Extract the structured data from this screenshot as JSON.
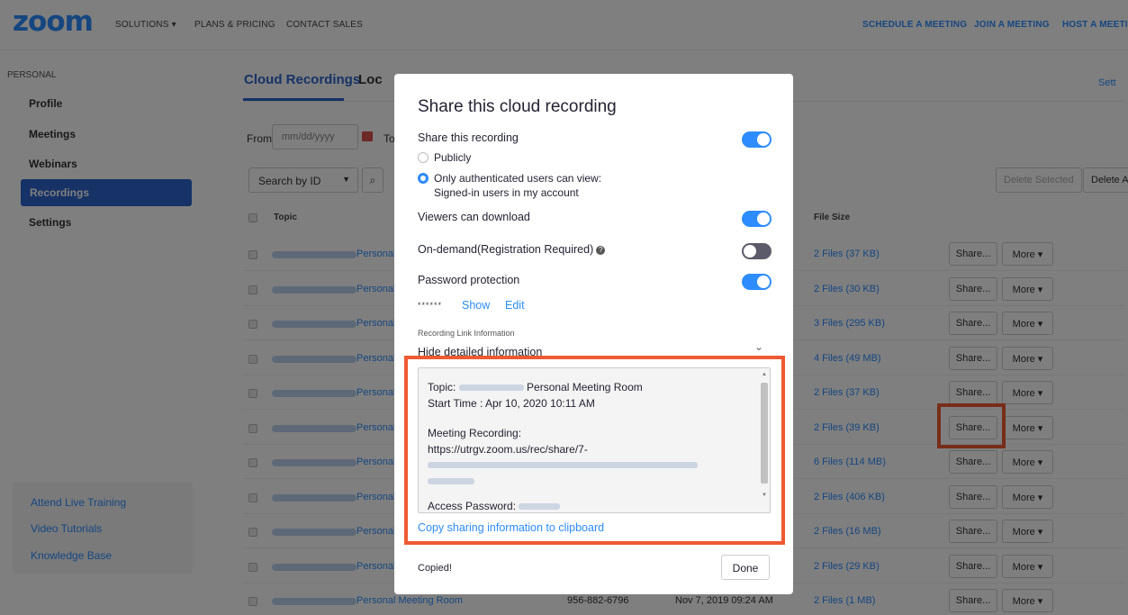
{
  "nav": {
    "logo": "zoom",
    "solutions": "SOLUTIONS ▾",
    "plans": "PLANS & PRICING",
    "contact": "CONTACT SALES",
    "schedule": "SCHEDULE A MEETING",
    "join": "JOIN A MEETING",
    "host": "HOST A MEETING"
  },
  "sidebar": {
    "heading": "PERSONAL",
    "items": [
      "Profile",
      "Meetings",
      "Webinars",
      "Recordings",
      "Settings"
    ],
    "footer": [
      "Attend Live Training",
      "Video Tutorials",
      "Knowledge Base"
    ]
  },
  "main": {
    "tabs": [
      "Cloud Recordings",
      "Loc"
    ],
    "settings_link": "Sett",
    "from_label": "From",
    "date_placeholder": "mm/dd/yyyy",
    "to_label": "To",
    "search_by": "Search by ID",
    "delete_selected": "Delete Selected",
    "delete_all": "Delete A",
    "col_topic": "Topic",
    "col_file_size": "File Size",
    "share_label": "Share...",
    "more_label": "More ▾",
    "rows": [
      {
        "topic": "Personal",
        "size": "2 Files (37 KB)"
      },
      {
        "topic": "Personal",
        "size": "2 Files (30 KB)"
      },
      {
        "topic": "Personal",
        "size": "3 Files (295 KB)"
      },
      {
        "topic": "Personal",
        "size": "4 Files (49 MB)"
      },
      {
        "topic": "Personal",
        "size": "2 Files (37 KB)"
      },
      {
        "topic": "Personal",
        "size": "2 Files (39 KB)"
      },
      {
        "topic": "Personal",
        "size": "6 Files (114 MB)"
      },
      {
        "topic": "Personal",
        "size": "2 Files (406 KB)"
      },
      {
        "topic": "Personal",
        "size": "2 Files (16 MB)"
      },
      {
        "topic": "Personal",
        "size": "2 Files (29 KB)"
      },
      {
        "topic": "Personal Meeting Room",
        "size": "2 Files (1 MB)"
      }
    ],
    "last_row_id": "956-882-6796",
    "last_row_date": "Nov 7, 2019 09:24 AM"
  },
  "modal": {
    "title": "Share this cloud recording",
    "share_recording": "Share this recording",
    "publicly": "Publicly",
    "authenticated": "Only authenticated users can view:",
    "signed_in": "Signed-in users in my account",
    "viewers_download": "Viewers can download",
    "on_demand": "On-demand(Registration Required)",
    "password_protection": "Password protection",
    "password_mask": "******",
    "show": "Show",
    "edit": "Edit",
    "link_info": "Recording Link Information",
    "hide_details": "Hide detailed information",
    "topic_prefix": "Topic:",
    "topic_suffix": "Personal Meeting Room",
    "start_time": "Start Time : Apr 10, 2020 10:11 AM",
    "meeting_recording": "Meeting Recording:",
    "url": "https://utrgv.zoom.us/rec/share/7-",
    "access_password": "Access Password:",
    "copy_link": "Copy sharing information to clipboard",
    "copied": "Copied!",
    "done": "Done",
    "toggles": {
      "share": true,
      "download": true,
      "on_demand": false,
      "password": true
    }
  },
  "colors": {
    "accent": "#2d8cff",
    "highlight": "#ee5a32",
    "sidebar_active": "#2d64cc"
  }
}
